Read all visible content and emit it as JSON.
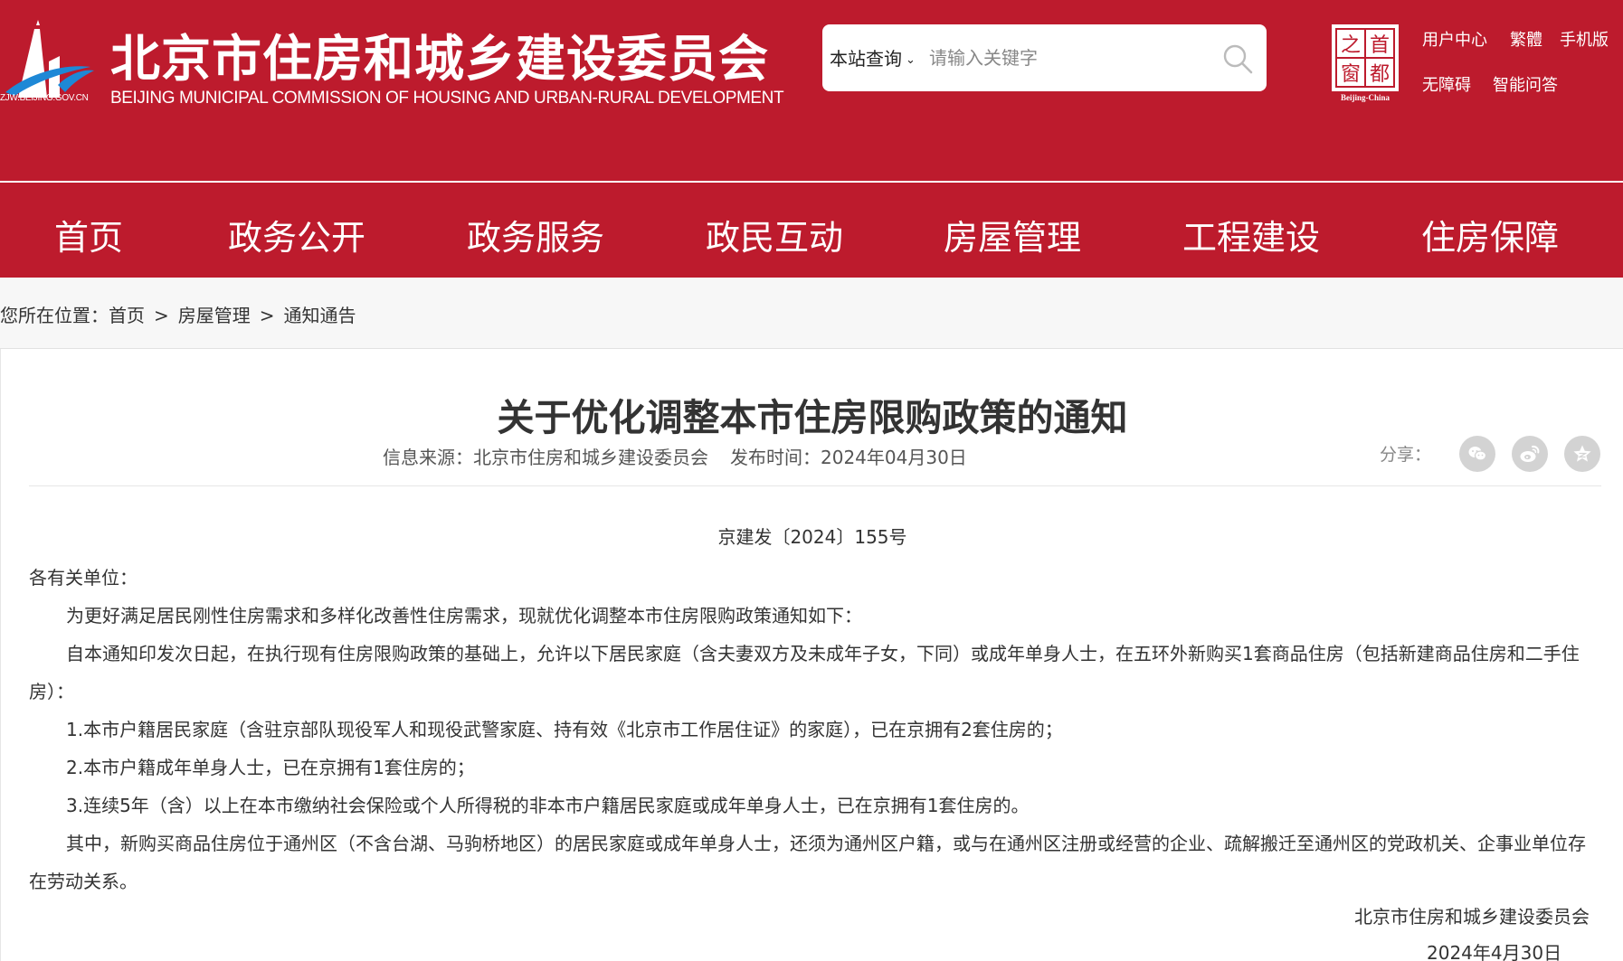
{
  "header": {
    "logo_url_text": "ZJW.BEIJING.GOV.CN",
    "title_cn": "北京市住房和城乡建设委员会",
    "title_en": "BEIJING MUNICIPAL COMMISSION OF HOUSING AND URBAN-RURAL DEVELOPMENT",
    "capital_logo_text": [
      "之",
      "首",
      "窗",
      "都"
    ],
    "capital_logo_caption": "Beijing-China"
  },
  "search": {
    "scope_label": "本站查询",
    "placeholder": "请输入关键字"
  },
  "top_links": [
    "用户中心",
    "繁體",
    "手机版",
    "无障碍",
    "智能问答"
  ],
  "nav": [
    "首页",
    "政务公开",
    "政务服务",
    "政民互动",
    "房屋管理",
    "工程建设",
    "住房保障"
  ],
  "breadcrumb": {
    "prefix": "您所在位置：",
    "items": [
      "首页",
      "房屋管理",
      "通知通告"
    ],
    "separator": ">"
  },
  "article": {
    "title": "关于优化调整本市住房限购政策的通知",
    "source": "信息来源：北京市住房和城乡建设委员会",
    "publish_time": "发布时间：2024年04月30日",
    "share_label": "分享：",
    "doc_number": "京建发〔2024〕155号",
    "salutation": "各有关单位：",
    "paragraphs": [
      "为更好满足居民刚性住房需求和多样化改善性住房需求，现就优化调整本市住房限购政策通知如下：",
      "自本通知印发次日起，在执行现有住房限购政策的基础上，允许以下居民家庭（含夫妻双方及未成年子女，下同）或成年单身人士，在五环外新购买1套商品住房（包括新建商品住房和二手住房）：",
      "1.本市户籍居民家庭（含驻京部队现役军人和现役武警家庭、持有效《北京市工作居住证》的家庭），已在京拥有2套住房的；",
      "2.本市户籍成年单身人士，已在京拥有1套住房的；",
      "3.连续5年（含）以上在本市缴纳社会保险或个人所得税的非本市户籍居民家庭或成年单身人士，已在京拥有1套住房的。",
      "其中，新购买商品住房位于通州区（不含台湖、马驹桥地区）的居民家庭或成年单身人士，还须为通州区户籍，或与在通州区注册或经营的企业、疏解搬迁至通州区的党政机关、企事业单位存在劳动关系。"
    ],
    "signature_org": "北京市住房和城乡建设委员会",
    "signature_date": "2024年4月30日"
  },
  "colors": {
    "brand_red": "#bd1b2d",
    "breadcrumb_bg": "#f7f7f7",
    "text": "#333333",
    "share_icon_bg": "#d3d3d3"
  },
  "icons": [
    "logo-building-icon",
    "search-icon",
    "chevron-down-icon",
    "wechat-icon",
    "weibo-icon",
    "qzone-star-icon"
  ]
}
